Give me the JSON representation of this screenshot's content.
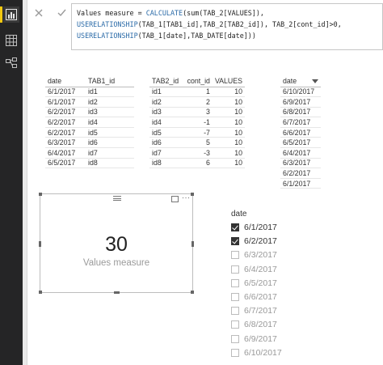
{
  "formula": {
    "lines": [
      [
        {
          "t": "Values measure = "
        },
        {
          "t": "CALCULATE",
          "kw": true
        },
        {
          "t": "(sum(TAB_2[VALUES]),"
        }
      ],
      [
        {
          "t": "USERELATIONSHIP",
          "kw": true
        },
        {
          "t": "(TAB_1[TAB1_id],TAB_2[TAB2_id]), TAB_2[cont_id]>0,"
        }
      ],
      [
        {
          "t": "USERELATIONSHIP",
          "kw": true
        },
        {
          "t": "(TAB_1[date],TAB_DATE[date]))"
        }
      ]
    ]
  },
  "tab1": {
    "headers": [
      "date",
      "TAB1_id"
    ],
    "rows": [
      [
        "6/1/2017",
        "id1"
      ],
      [
        "6/1/2017",
        "id2"
      ],
      [
        "6/2/2017",
        "id3"
      ],
      [
        "6/2/2017",
        "id4"
      ],
      [
        "6/2/2017",
        "id5"
      ],
      [
        "6/3/2017",
        "id6"
      ],
      [
        "6/4/2017",
        "id7"
      ],
      [
        "6/5/2017",
        "id8"
      ]
    ]
  },
  "tab2": {
    "headers": [
      "TAB2_id",
      "cont_id",
      "VALUES"
    ],
    "rows": [
      [
        "id1",
        "1",
        "10"
      ],
      [
        "id2",
        "2",
        "10"
      ],
      [
        "id3",
        "3",
        "10"
      ],
      [
        "id4",
        "-1",
        "10"
      ],
      [
        "id5",
        "-7",
        "10"
      ],
      [
        "id6",
        "5",
        "10"
      ],
      [
        "id7",
        "-3",
        "10"
      ],
      [
        "id8",
        "6",
        "10"
      ]
    ]
  },
  "tabdate": {
    "header": "date",
    "rows": [
      "6/10/2017",
      "6/9/2017",
      "6/8/2017",
      "6/7/2017",
      "6/6/2017",
      "6/5/2017",
      "6/4/2017",
      "6/3/2017",
      "6/2/2017",
      "6/1/2017"
    ]
  },
  "card": {
    "value": "30",
    "label": "Values measure"
  },
  "slicer": {
    "title": "date",
    "items": [
      {
        "label": "6/1/2017",
        "checked": true
      },
      {
        "label": "6/2/2017",
        "checked": true
      },
      {
        "label": "6/3/2017",
        "checked": false
      },
      {
        "label": "6/4/2017",
        "checked": false
      },
      {
        "label": "6/5/2017",
        "checked": false
      },
      {
        "label": "6/6/2017",
        "checked": false
      },
      {
        "label": "6/7/2017",
        "checked": false
      },
      {
        "label": "6/8/2017",
        "checked": false
      },
      {
        "label": "6/9/2017",
        "checked": false
      },
      {
        "label": "6/10/2017",
        "checked": false
      }
    ]
  },
  "icons": {
    "rail": [
      "report-view-icon",
      "data-view-icon",
      "model-view-icon"
    ],
    "formula": [
      "close-icon",
      "check-icon"
    ],
    "card": [
      "move-grip-icon",
      "focus-mode-icon",
      "more-options-icon"
    ]
  },
  "colors": {
    "rail_bg": "#252526",
    "active_accent": "#f2c811",
    "dax_keyword": "#2b6ba8"
  }
}
